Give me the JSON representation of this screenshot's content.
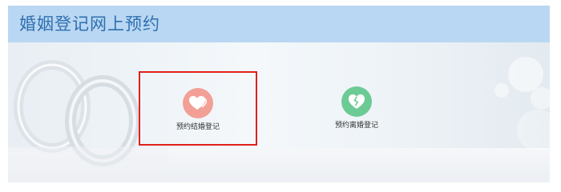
{
  "header": {
    "title": "婚姻登记网上预约"
  },
  "options": [
    {
      "label": "预约结婚登记",
      "icon": "hearts-icon",
      "color": "#f2a096",
      "selected": true
    },
    {
      "label": "预约离婚登记",
      "icon": "broken-heart-icon",
      "color": "#6ccb95",
      "selected": false
    }
  ],
  "colors": {
    "header_bg": "#b9d7f2",
    "title": "#2f6fb0",
    "selection_border": "#e1201c"
  }
}
